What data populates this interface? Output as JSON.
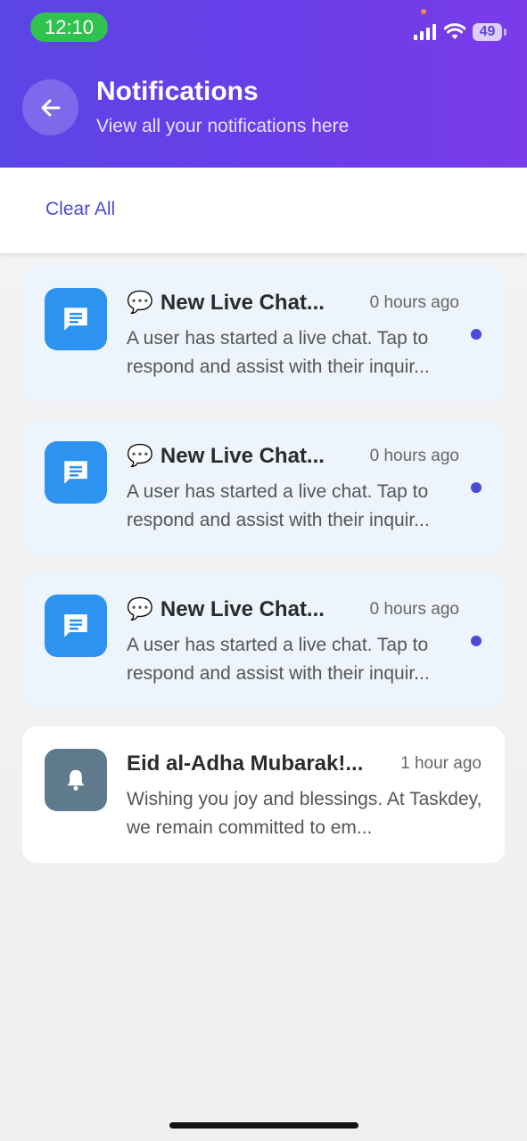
{
  "status_bar": {
    "time": "12:10",
    "battery": "49",
    "signal_icon": "signal-icon",
    "wifi_icon": "wifi-icon"
  },
  "header": {
    "back_icon": "arrow-left-icon",
    "title": "Notifications",
    "subtitle": "View all your notifications here"
  },
  "toolbar": {
    "clear_all_label": "Clear All"
  },
  "notifications": [
    {
      "icon": "chat-icon",
      "title_emoji": "💬",
      "title": "New Live Chat...",
      "time": "0 hours ago",
      "body": "A user has started a live chat. Tap to respond and assist with their inquir...",
      "unread": true
    },
    {
      "icon": "chat-icon",
      "title_emoji": "💬",
      "title": "New Live Chat...",
      "time": "0 hours ago",
      "body": "A user has started a live chat. Tap to respond and assist with their inquir...",
      "unread": true
    },
    {
      "icon": "chat-icon",
      "title_emoji": "💬",
      "title": "New Live Chat...",
      "time": "0 hours ago",
      "body": "A user has started a live chat. Tap to respond and assist with their inquir...",
      "unread": true
    },
    {
      "icon": "bell-icon",
      "title_emoji": "",
      "title": "Eid al-Adha Mubarak!...",
      "time": "1 hour ago",
      "body": "Wishing you joy and blessings. At Taskdey, we remain committed to em...",
      "unread": false
    }
  ],
  "colors": {
    "header_start": "#5b45e6",
    "header_end": "#7b3bea",
    "accent": "#4b49d8",
    "chat_icon_bg": "#2d93f1",
    "bell_icon_bg": "#5f7a8c",
    "unread_card_bg": "#eef4fc"
  }
}
